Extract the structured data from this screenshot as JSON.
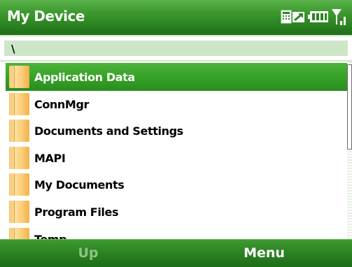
{
  "title_bar": {
    "title": "My Device",
    "status_icons": [
      "data-connection-icon",
      "battery-icon",
      "signal-strength-icon"
    ]
  },
  "path_bar": {
    "path": "\\"
  },
  "file_list": {
    "items": [
      {
        "label": "Application Data",
        "icon": "folder-icon",
        "selected": true
      },
      {
        "label": "ConnMgr",
        "icon": "folder-icon",
        "selected": false
      },
      {
        "label": "Documents and Settings",
        "icon": "folder-icon",
        "selected": false
      },
      {
        "label": "MAPI",
        "icon": "folder-icon",
        "selected": false
      },
      {
        "label": "My Documents",
        "icon": "folder-icon",
        "selected": false
      },
      {
        "label": "Program Files",
        "icon": "folder-icon",
        "selected": false
      },
      {
        "label": "Temp",
        "icon": "folder-icon",
        "selected": false
      }
    ]
  },
  "softkeys": {
    "left": "Up",
    "right": "Menu"
  },
  "colors": {
    "accent_green": "#2c8422",
    "selection_green": "#36a227",
    "path_bar_bg": "#cde6c7",
    "disabled_softkey": "#8fc388"
  }
}
